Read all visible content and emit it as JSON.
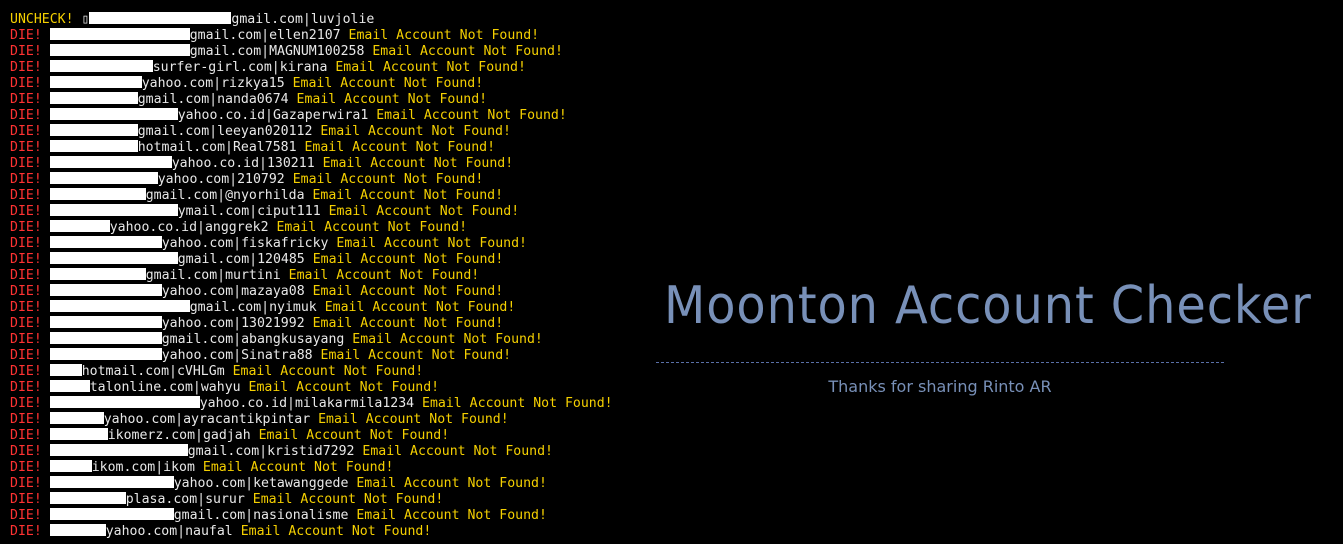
{
  "terminal": {
    "lines": [
      {
        "status": "UNCHECK!",
        "before": " ▯",
        "after": "gmail.com|luvjolie",
        "message": ""
      },
      {
        "status": "DIE!",
        "before": "",
        "after": "gmail.com|ellen2107",
        "message": "Email Account Not Found!"
      },
      {
        "status": "DIE!",
        "before": "",
        "after": "gmail.com|MAGNUM100258",
        "message": "Email Account Not Found!"
      },
      {
        "status": "DIE!",
        "before": "",
        "after": "surfer-girl.com|kirana",
        "message": "Email Account Not Found!"
      },
      {
        "status": "DIE!",
        "before": "",
        "after": "yahoo.com|rizkya15",
        "message": "Email Account Not Found!"
      },
      {
        "status": "DIE!",
        "before": "",
        "after": "gmail.com|nanda0674",
        "message": "Email Account Not Found!"
      },
      {
        "status": "DIE!",
        "before": "",
        "after": "yahoo.co.id|Gazaperwira1",
        "message": "Email Account Not Found!"
      },
      {
        "status": "DIE!",
        "before": "",
        "after": "gmail.com|leeyan020112",
        "message": "Email Account Not Found!"
      },
      {
        "status": "DIE!",
        "before": "",
        "after": "hotmail.com|Real7581",
        "message": "Email Account Not Found!"
      },
      {
        "status": "DIE!",
        "before": "",
        "after": "yahoo.co.id|130211",
        "message": "Email Account Not Found!"
      },
      {
        "status": "DIE!",
        "before": "",
        "after": "yahoo.com|210792",
        "message": "Email Account Not Found!"
      },
      {
        "status": "DIE!",
        "before": "",
        "after": "gmail.com|@nyorhilda",
        "message": "Email Account Not Found!"
      },
      {
        "status": "DIE!",
        "before": "",
        "after": "ymail.com|ciput111",
        "message": "Email Account Not Found!"
      },
      {
        "status": "DIE!",
        "before": "",
        "after": "yahoo.co.id|anggrek2",
        "message": "Email Account Not Found!"
      },
      {
        "status": "DIE!",
        "before": "",
        "after": "yahoo.com|fiskafricky",
        "message": "Email Account Not Found!"
      },
      {
        "status": "DIE!",
        "before": "",
        "after": "gmail.com|120485",
        "message": "Email Account Not Found!"
      },
      {
        "status": "DIE!",
        "before": "",
        "after": "gmail.com|murtini",
        "message": "Email Account Not Found!"
      },
      {
        "status": "DIE!",
        "before": "",
        "after": "yahoo.com|mazaya08",
        "message": "Email Account Not Found!"
      },
      {
        "status": "DIE!",
        "before": "",
        "after": "gmail.com|nyimuk",
        "message": "Email Account Not Found!"
      },
      {
        "status": "DIE!",
        "before": "",
        "after": "yahoo.com|13021992",
        "message": "Email Account Not Found!"
      },
      {
        "status": "DIE!",
        "before": "",
        "after": "gmail.com|abangkusayang",
        "message": "Email Account Not Found!"
      },
      {
        "status": "DIE!",
        "before": "",
        "after": "yahoo.com|Sinatra88",
        "message": "Email Account Not Found!"
      },
      {
        "status": "DIE!",
        "before": "",
        "after": "hotmail.com|cVHLGm",
        "message": "Email Account Not Found!"
      },
      {
        "status": "DIE!",
        "before": "",
        "after": "talonline.com|wahyu",
        "message": "Email Account Not Found!"
      },
      {
        "status": "DIE!",
        "before": "",
        "after": "yahoo.co.id|milakarmila1234",
        "message": "Email Account Not Found!"
      },
      {
        "status": "DIE!",
        "before": "",
        "after": "yahoo.com|ayracantikpintar",
        "message": "Email Account Not Found!"
      },
      {
        "status": "DIE!",
        "before": "",
        "after": "ikomerz.com|gadjah",
        "message": "Email Account Not Found!"
      },
      {
        "status": "DIE!",
        "before": "",
        "after": "gmail.com|kristid7292",
        "message": "Email Account Not Found!"
      },
      {
        "status": "DIE!",
        "before": "",
        "after": "ikom.com|ikom",
        "message": "Email Account Not Found!"
      },
      {
        "status": "DIE!",
        "before": "",
        "after": "yahoo.com|ketawanggede",
        "message": "Email Account Not Found!"
      },
      {
        "status": "DIE!",
        "before": "",
        "after": "plasa.com|surur",
        "message": "Email Account Not Found!"
      },
      {
        "status": "DIE!",
        "before": "",
        "after": "gmail.com|nasionalisme",
        "message": "Email Account Not Found!"
      },
      {
        "status": "DIE!",
        "before": "",
        "after": "yahoo.com|naufal",
        "message": "Email Account Not Found!"
      }
    ]
  },
  "banner": {
    "title": "Moonton Account Checker",
    "credit": "Thanks for sharing Rinto AR"
  },
  "colors": {
    "background": "#000000",
    "die": "#ff3232",
    "uncheck": "#f5d000",
    "message": "#f5d000",
    "text": "#e8e8e8",
    "banner": "#7890b8"
  }
}
